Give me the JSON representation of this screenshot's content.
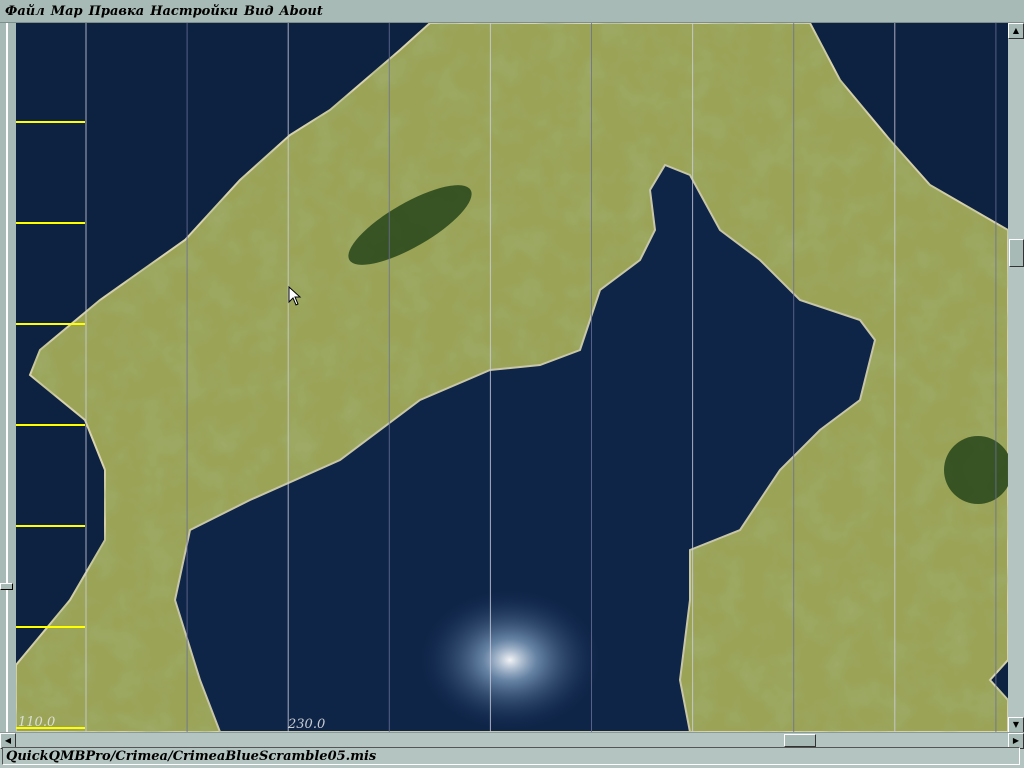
{
  "menu": {
    "items": [
      "Файл",
      "Map",
      "Правка",
      "Настройки",
      "Вид",
      "About"
    ]
  },
  "map": {
    "axis_labels": [
      "110.0",
      "230.0"
    ],
    "colors": {
      "water": "#0d2140",
      "land": "#8f9a4c",
      "forest": "#2e4a1e",
      "grid_line": "#8a8fb0",
      "tick": "#ffff00"
    }
  },
  "status": {
    "path": "QuickQMBPro/Crimea/CrimeaBlueScramble05.mis"
  }
}
